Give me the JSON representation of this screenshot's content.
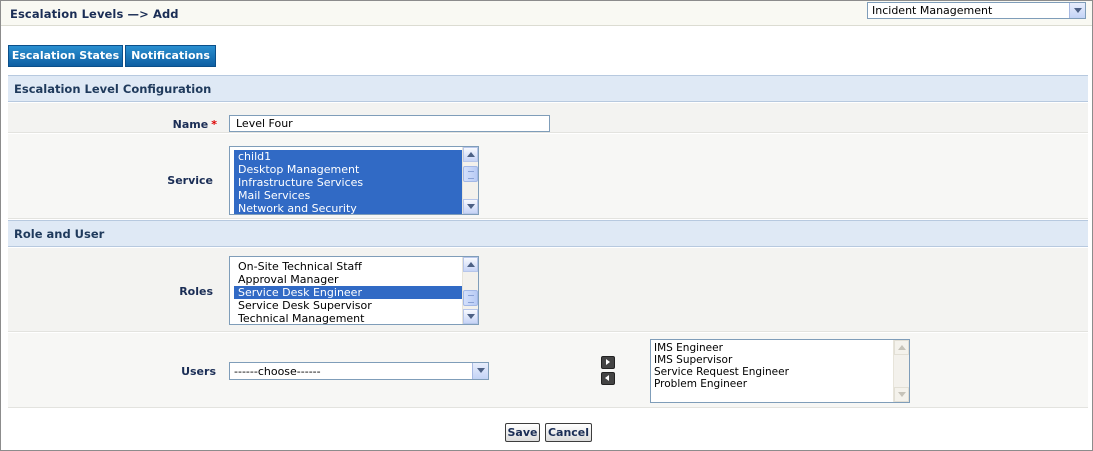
{
  "header": {
    "title": "Escalation Levels —> Add",
    "module_selected": "Incident Management"
  },
  "tabs": [
    {
      "label": "Escalation States"
    },
    {
      "label": "Notifications"
    }
  ],
  "sections": {
    "config": "Escalation Level Configuration",
    "role_user": "Role and User"
  },
  "form": {
    "name_label": "Name",
    "required_mark": "*",
    "name_value": "Level Four",
    "service_label": "Service",
    "services": [
      {
        "label": "child1",
        "selected": true
      },
      {
        "label": "Desktop Management",
        "selected": true
      },
      {
        "label": "Infrastructure Services",
        "selected": true
      },
      {
        "label": "Mail Services",
        "selected": true
      },
      {
        "label": "Network and Security",
        "selected": true
      }
    ],
    "roles_label": "Roles",
    "roles": [
      {
        "label": "On-Site Technical Staff",
        "selected": false
      },
      {
        "label": "Approval Manager",
        "selected": false
      },
      {
        "label": "Service Desk Engineer",
        "selected": true
      },
      {
        "label": "Service Desk Supervisor",
        "selected": false
      },
      {
        "label": "Technical Management",
        "selected": false
      }
    ],
    "users_label": "Users",
    "users_select_value": "------choose------",
    "selected_users": [
      "IMS Engineer",
      "IMS Supervisor",
      "Service Request Engineer",
      "Problem Engineer"
    ]
  },
  "buttons": {
    "save": "Save",
    "cancel": "Cancel"
  },
  "colors": {
    "tab_blue": "#0e5fa3",
    "section_bg": "#dfe9f5",
    "selection": "#316ac5",
    "required": "#dd0000"
  }
}
